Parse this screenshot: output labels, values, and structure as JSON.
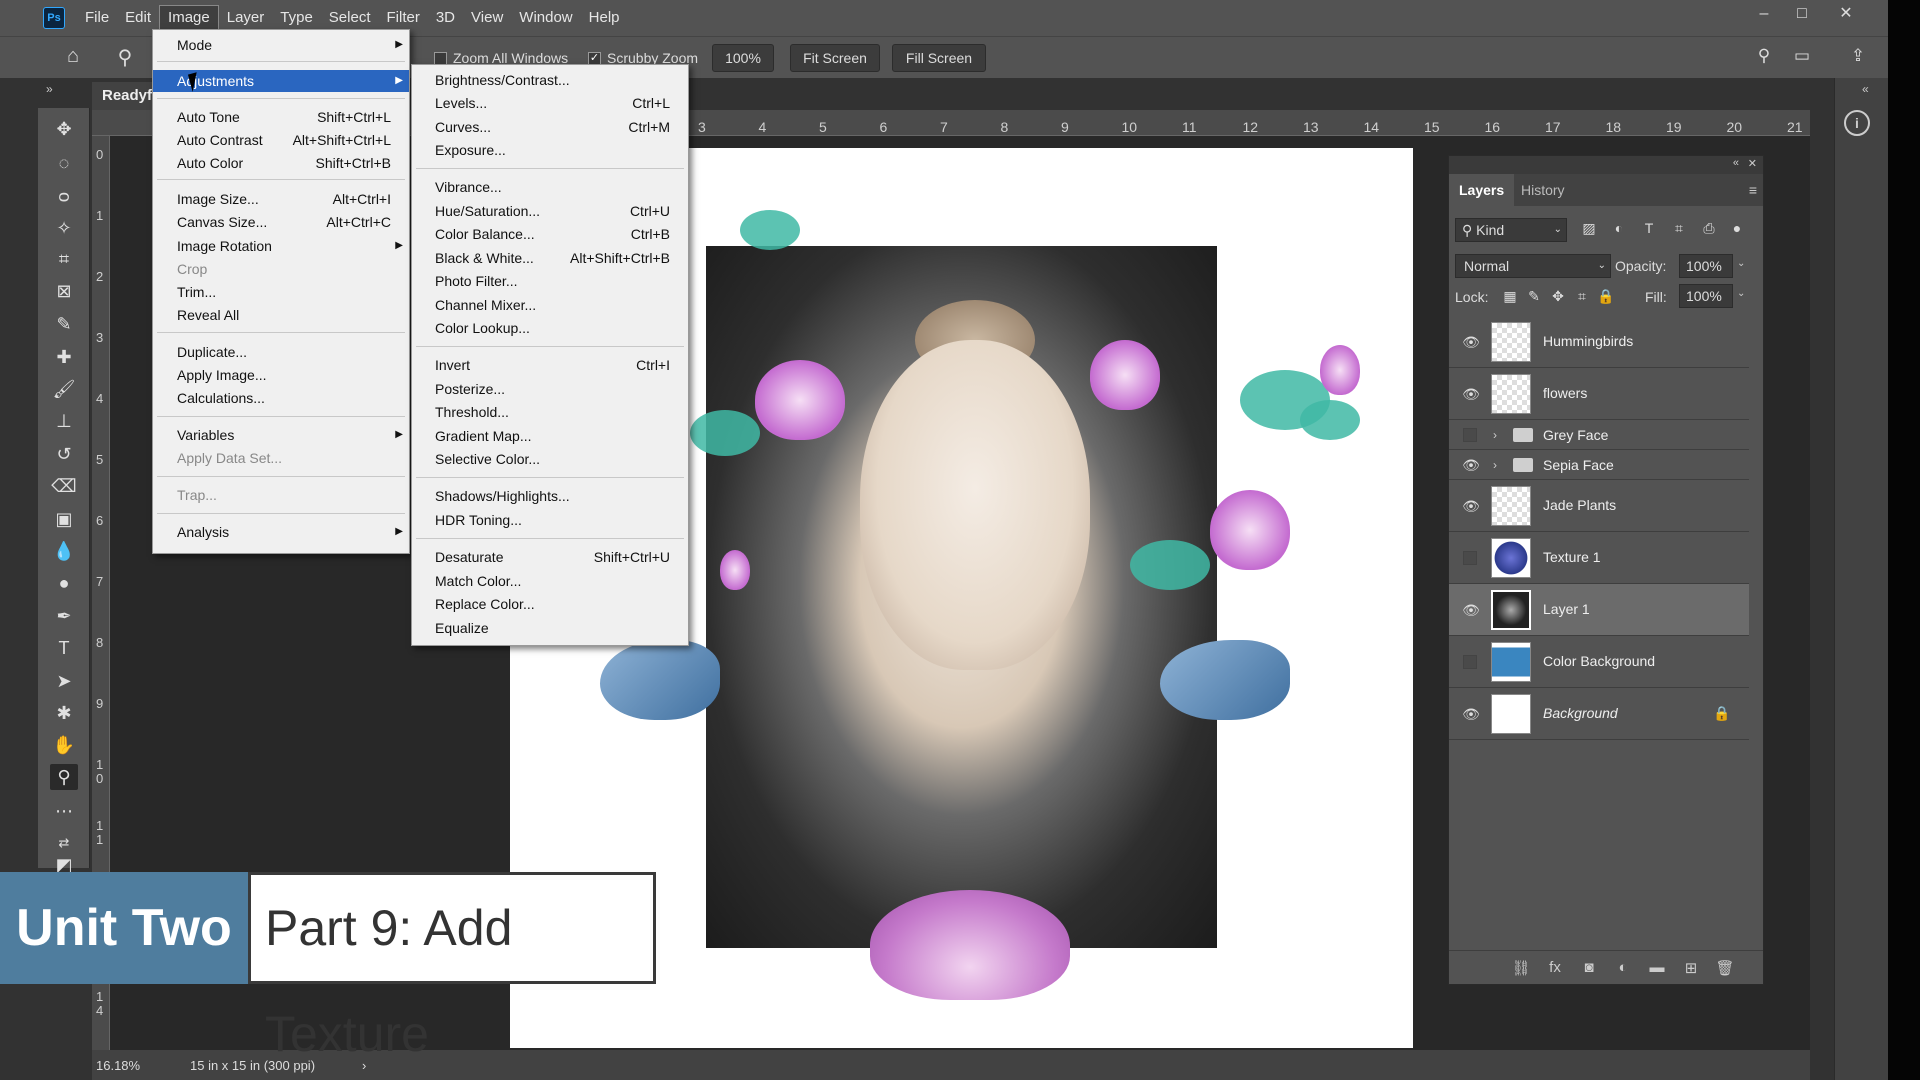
{
  "app": {
    "logo": "Ps"
  },
  "menubar": [
    "File",
    "Edit",
    "Image",
    "Layer",
    "Type",
    "Select",
    "Filter",
    "3D",
    "View",
    "Window",
    "Help"
  ],
  "window_controls": {
    "minimize": "–",
    "maximize": "□",
    "close": "✕"
  },
  "options": {
    "zoom_all_windows": "Zoom All Windows",
    "zoom_all_checked": false,
    "scrubby_zoom": "Scrubby Zoom",
    "scrubby_checked": true,
    "zoom_percent": "100%",
    "fit_screen": "Fit Screen",
    "fill_screen": "Fill Screen"
  },
  "document": {
    "tab": "Readyf",
    "zoom": "16.18%",
    "doc_size": "15 in x 15 in (300 ppi)",
    "ruler_top": [
      "3",
      "4",
      "5",
      "6",
      "7",
      "8",
      "9",
      "10",
      "11",
      "12",
      "13",
      "14",
      "15",
      "16",
      "17",
      "18",
      "19",
      "20",
      "21"
    ],
    "ruler_left": [
      "0",
      "1",
      "2",
      "3",
      "4",
      "5",
      "6",
      "7",
      "8",
      "9",
      "1\n0",
      "1\n1",
      "1\n4"
    ]
  },
  "image_menu": {
    "items": [
      {
        "label": "Mode",
        "submenu": true
      },
      {
        "label": "Adjustments",
        "submenu": true,
        "highlighted": true
      },
      {
        "label": "Auto Tone",
        "shortcut": "Shift+Ctrl+L"
      },
      {
        "label": "Auto Contrast",
        "shortcut": "Alt+Shift+Ctrl+L"
      },
      {
        "label": "Auto Color",
        "shortcut": "Shift+Ctrl+B"
      },
      {
        "label": "Image Size...",
        "shortcut": "Alt+Ctrl+I"
      },
      {
        "label": "Canvas Size...",
        "shortcut": "Alt+Ctrl+C"
      },
      {
        "label": "Image Rotation",
        "submenu": true
      },
      {
        "label": "Crop",
        "disabled": true
      },
      {
        "label": "Trim..."
      },
      {
        "label": "Reveal All"
      },
      {
        "label": "Duplicate..."
      },
      {
        "label": "Apply Image..."
      },
      {
        "label": "Calculations..."
      },
      {
        "label": "Variables",
        "submenu": true
      },
      {
        "label": "Apply Data Set...",
        "disabled": true
      },
      {
        "label": "Trap...",
        "disabled": true
      },
      {
        "label": "Analysis",
        "submenu": true
      }
    ]
  },
  "adjustments_menu": {
    "items": [
      {
        "label": "Brightness/Contrast..."
      },
      {
        "label": "Levels...",
        "shortcut": "Ctrl+L"
      },
      {
        "label": "Curves...",
        "shortcut": "Ctrl+M"
      },
      {
        "label": "Exposure..."
      },
      {
        "label": "Vibrance..."
      },
      {
        "label": "Hue/Saturation...",
        "shortcut": "Ctrl+U"
      },
      {
        "label": "Color Balance...",
        "shortcut": "Ctrl+B"
      },
      {
        "label": "Black & White...",
        "shortcut": "Alt+Shift+Ctrl+B"
      },
      {
        "label": "Photo Filter..."
      },
      {
        "label": "Channel Mixer..."
      },
      {
        "label": "Color Lookup..."
      },
      {
        "label": "Invert",
        "shortcut": "Ctrl+I"
      },
      {
        "label": "Posterize..."
      },
      {
        "label": "Threshold..."
      },
      {
        "label": "Gradient Map..."
      },
      {
        "label": "Selective Color..."
      },
      {
        "label": "Shadows/Highlights..."
      },
      {
        "label": "HDR Toning..."
      },
      {
        "label": "Desaturate",
        "shortcut": "Shift+Ctrl+U"
      },
      {
        "label": "Match Color..."
      },
      {
        "label": "Replace Color..."
      },
      {
        "label": "Equalize"
      }
    ]
  },
  "layers_panel": {
    "tabs": [
      "Layers",
      "History"
    ],
    "kind": "Kind",
    "blend_mode": "Normal",
    "opacity_label": "Opacity:",
    "opacity": "100%",
    "lock_label": "Lock:",
    "fill_label": "Fill:",
    "fill": "100%",
    "layers": [
      {
        "name": "Hummingbirds",
        "visible": true,
        "type": "layer"
      },
      {
        "name": "flowers",
        "visible": true,
        "type": "layer"
      },
      {
        "name": "Grey Face",
        "visible": false,
        "type": "group"
      },
      {
        "name": "Sepia Face",
        "visible": true,
        "type": "group"
      },
      {
        "name": "Jade Plants",
        "visible": true,
        "type": "layer"
      },
      {
        "name": "Texture 1",
        "visible": false,
        "type": "layer"
      },
      {
        "name": "Layer 1",
        "visible": true,
        "type": "layer",
        "selected": true
      },
      {
        "name": "Color Background",
        "visible": false,
        "type": "layer"
      },
      {
        "name": "Background",
        "visible": true,
        "type": "background",
        "locked": true
      }
    ]
  },
  "banner": {
    "unit": "Unit Two",
    "part": "Part 9: Add Texture"
  },
  "colors": {
    "accent": "#2a66c0",
    "banner_blue": "#4f7d9e"
  }
}
